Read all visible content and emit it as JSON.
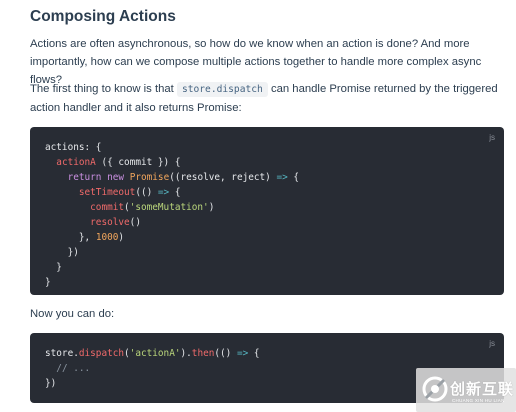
{
  "heading": "Composing Actions",
  "para1": "Actions are often asynchronous, so how do we know when an action is done? And more importantly, how can we compose multiple actions together to handle more complex async flows?",
  "para2": {
    "before": "The first thing to know is that ",
    "code": "store.dispatch",
    "after": " can handle Promise returned by the triggered action handler and it also returns Promise:"
  },
  "code1": {
    "lang": "js",
    "lines": [
      [
        {
          "t": "actions: {",
          "c": ""
        }
      ],
      [
        {
          "t": "  ",
          "c": ""
        },
        {
          "t": "actionA",
          "c": "red"
        },
        {
          "t": " ({ commit }) {",
          "c": ""
        }
      ],
      [
        {
          "t": "    ",
          "c": ""
        },
        {
          "t": "return",
          "c": "kw"
        },
        {
          "t": " ",
          "c": ""
        },
        {
          "t": "new",
          "c": "kw"
        },
        {
          "t": " ",
          "c": ""
        },
        {
          "t": "Promise",
          "c": "fn"
        },
        {
          "t": "((resolve, reject) ",
          "c": ""
        },
        {
          "t": "=>",
          "c": "op"
        },
        {
          "t": " {",
          "c": ""
        }
      ],
      [
        {
          "t": "      ",
          "c": ""
        },
        {
          "t": "setTimeout",
          "c": "red"
        },
        {
          "t": "(() ",
          "c": ""
        },
        {
          "t": "=>",
          "c": "op"
        },
        {
          "t": " {",
          "c": ""
        }
      ],
      [
        {
          "t": "        ",
          "c": ""
        },
        {
          "t": "commit",
          "c": "red"
        },
        {
          "t": "(",
          "c": ""
        },
        {
          "t": "'someMutation'",
          "c": "str"
        },
        {
          "t": ")",
          "c": ""
        }
      ],
      [
        {
          "t": "        ",
          "c": ""
        },
        {
          "t": "resolve",
          "c": "red"
        },
        {
          "t": "()",
          "c": ""
        }
      ],
      [
        {
          "t": "      }, ",
          "c": ""
        },
        {
          "t": "1000",
          "c": "num"
        },
        {
          "t": ")",
          "c": ""
        }
      ],
      [
        {
          "t": "    })",
          "c": ""
        }
      ],
      [
        {
          "t": "  }",
          "c": ""
        }
      ],
      [
        {
          "t": "}",
          "c": ""
        }
      ]
    ]
  },
  "para3": "Now you can do:",
  "code2": {
    "lang": "js",
    "lines": [
      [
        {
          "t": "store.",
          "c": ""
        },
        {
          "t": "dispatch",
          "c": "red"
        },
        {
          "t": "(",
          "c": ""
        },
        {
          "t": "'actionA'",
          "c": "str"
        },
        {
          "t": ").",
          "c": ""
        },
        {
          "t": "then",
          "c": "red"
        },
        {
          "t": "(() ",
          "c": ""
        },
        {
          "t": "=>",
          "c": "op"
        },
        {
          "t": " {",
          "c": ""
        }
      ],
      [
        {
          "t": "  ",
          "c": ""
        },
        {
          "t": "// ...",
          "c": "cm"
        }
      ],
      [
        {
          "t": "})",
          "c": ""
        }
      ]
    ]
  },
  "watermark": {
    "text": "创新互联",
    "sub": "CHUANG XIN HU LIAN"
  }
}
